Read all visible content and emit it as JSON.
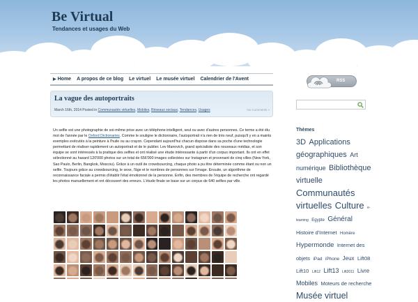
{
  "site": {
    "title": "Be Virtual",
    "tagline": "Tendances et usages du Web"
  },
  "nav": [
    {
      "label": "Home"
    },
    {
      "label": "A propos de ce blog"
    },
    {
      "label": "Le virtuel"
    },
    {
      "label": "Le musée virtuel"
    },
    {
      "label": "Calendrier de l'Avent"
    }
  ],
  "rss": {
    "label": "RSS"
  },
  "search": {
    "value": ""
  },
  "post": {
    "title": "La vague des autoportraits",
    "meta_date": "March 16th, 2014 Posted in",
    "categories": [
      "Communautés virtuelles",
      "Mobiles",
      "Réseaux sociaux",
      "Tendances",
      "Usages"
    ],
    "comments": "No Comments »",
    "body_pre": "Un selfie est une photographie de soi-même prise avec un téléphone intelligent, seul ou avec d'autres personnes. Ce terme a été élu mot de l'année par le ",
    "body_link": "Oxford Dictionaries",
    "body_post": ". Comme le souligne le dictionnaire, l'autoportrait n'a rien de très neuf, puisqu'il y en a maints exemples exécutés à la peinture à l'huile ou au crayon. Cependant aujourd'hui chacun dispose dans sa poche d'une technologie permettant de réaliser rapidement un autoportrait et de le publier. Lev Manovich, grand spécialiste des nouveaux médias, et son équipe se sont intéressés à la pratique des selfies et ont réalisé une étude intéressante à partir d'un corpus important. Ils ont en effet sélectionné au hasard 120'000 photos sur un total de  656'000 images collectées sur Instagram et provenant de cinq villes (New York, Sao Paulo, Berlin, Bangkok, Moscou). Grâce à un outil de crowdsourcing, chaque photo a pu être déterminée comme étant ou non un selfie. Toujours grâce au crowdsourcing, le sexe, l'âge et le nombres de personnes sur l'image. Ensuite, un algorithme de reconnaissance faciale a permis d'établir l'état émotionnel de la personne. Enfin, des membres de l'équipe de recherche ont regardé les photos manuellement et ont découvert des erreurs. L'étude finale se base sur un corpus de 640 selfies par ville."
  },
  "sidebar": {
    "themes_heading": "Thèmes",
    "tags": [
      {
        "label": "3D",
        "size": 11
      },
      {
        "label": "Applications géographiques",
        "size": 11
      },
      {
        "label": "Art numérique",
        "size": 9
      },
      {
        "label": "Bibliothèque virtuelle",
        "size": 11
      },
      {
        "label": "Communautés virtuelles",
        "size": 13
      },
      {
        "label": "Culture",
        "size": 13
      },
      {
        "label": "e-learning",
        "size": 5
      },
      {
        "label": "Egypte",
        "size": 6
      },
      {
        "label": "Général",
        "size": 10
      },
      {
        "label": "Histoire d'Internet",
        "size": 7.5
      },
      {
        "label": "Homère",
        "size": 6
      },
      {
        "label": "Hypermonde",
        "size": 9.5
      },
      {
        "label": "Internet des objets",
        "size": 7.5
      },
      {
        "label": "iPad",
        "size": 6.5
      },
      {
        "label": "iPhone",
        "size": 6.5
      },
      {
        "label": "Jeux",
        "size": 8
      },
      {
        "label": "Lift08",
        "size": 7.5
      },
      {
        "label": "Lift10",
        "size": 7.5
      },
      {
        "label": "Lift12",
        "size": 5
      },
      {
        "label": "Lift13",
        "size": 9
      },
      {
        "label": "Lift2011",
        "size": 5
      },
      {
        "label": "Livre",
        "size": 8
      },
      {
        "label": "Mobiles",
        "size": 9
      },
      {
        "label": "Moteurs de recherche",
        "size": 7.5
      },
      {
        "label": "Musée virtuel",
        "size": 12.5
      }
    ]
  },
  "colors": {
    "accent": "#2a5a8a",
    "title": "#1f3b55",
    "search_button": "#6aa84f"
  },
  "icons": {
    "rss": "cloud-wifi-icon",
    "search": "search-icon",
    "nav_marker": "arrow-right-icon"
  }
}
